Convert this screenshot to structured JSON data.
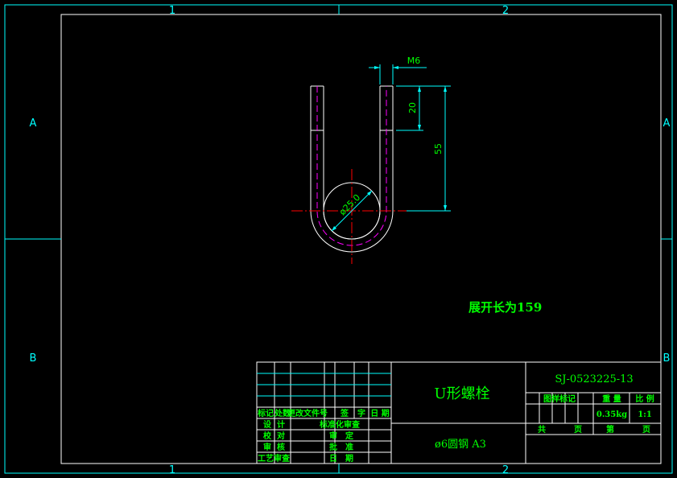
{
  "border": {
    "zones_top": [
      "1",
      "2"
    ],
    "zones_bottom": [
      "1",
      "2"
    ],
    "zones_left": [
      "A",
      "B"
    ],
    "zones_right": [
      "A",
      "B"
    ]
  },
  "dimensions": {
    "thread": "M6",
    "leg_length": "20",
    "total_height": "55",
    "diameter": "ø25.0"
  },
  "note": "展开长为159",
  "title_block": {
    "part_name": "U形螺栓",
    "material": "ø6圆钢 A3",
    "drawing_no": "SJ-0523225-13",
    "revision_headers": [
      "标记",
      "处数",
      "更改文件号",
      "签",
      "字",
      "日 期"
    ],
    "signoff_left": [
      {
        "role": "设",
        "role2": "计"
      },
      {
        "role": "校",
        "role2": "对"
      },
      {
        "role": "审",
        "role2": "核"
      },
      {
        "role": "工艺审查",
        "role2": ""
      }
    ],
    "signoff_right": [
      {
        "a": "标准化审查",
        "b": ""
      },
      {
        "a": "审",
        "b": "定"
      },
      {
        "a": "批",
        "b": "准"
      },
      {
        "a": "日",
        "b": "期"
      }
    ],
    "info_headers": [
      "图样标记",
      "重 量",
      "比 例"
    ],
    "weight": "0.35kg",
    "scale": "1:1",
    "sheet_total_label": "共",
    "sheet_label": "页",
    "sheet_no_label": "第",
    "sheet_no_suffix": "页"
  }
}
